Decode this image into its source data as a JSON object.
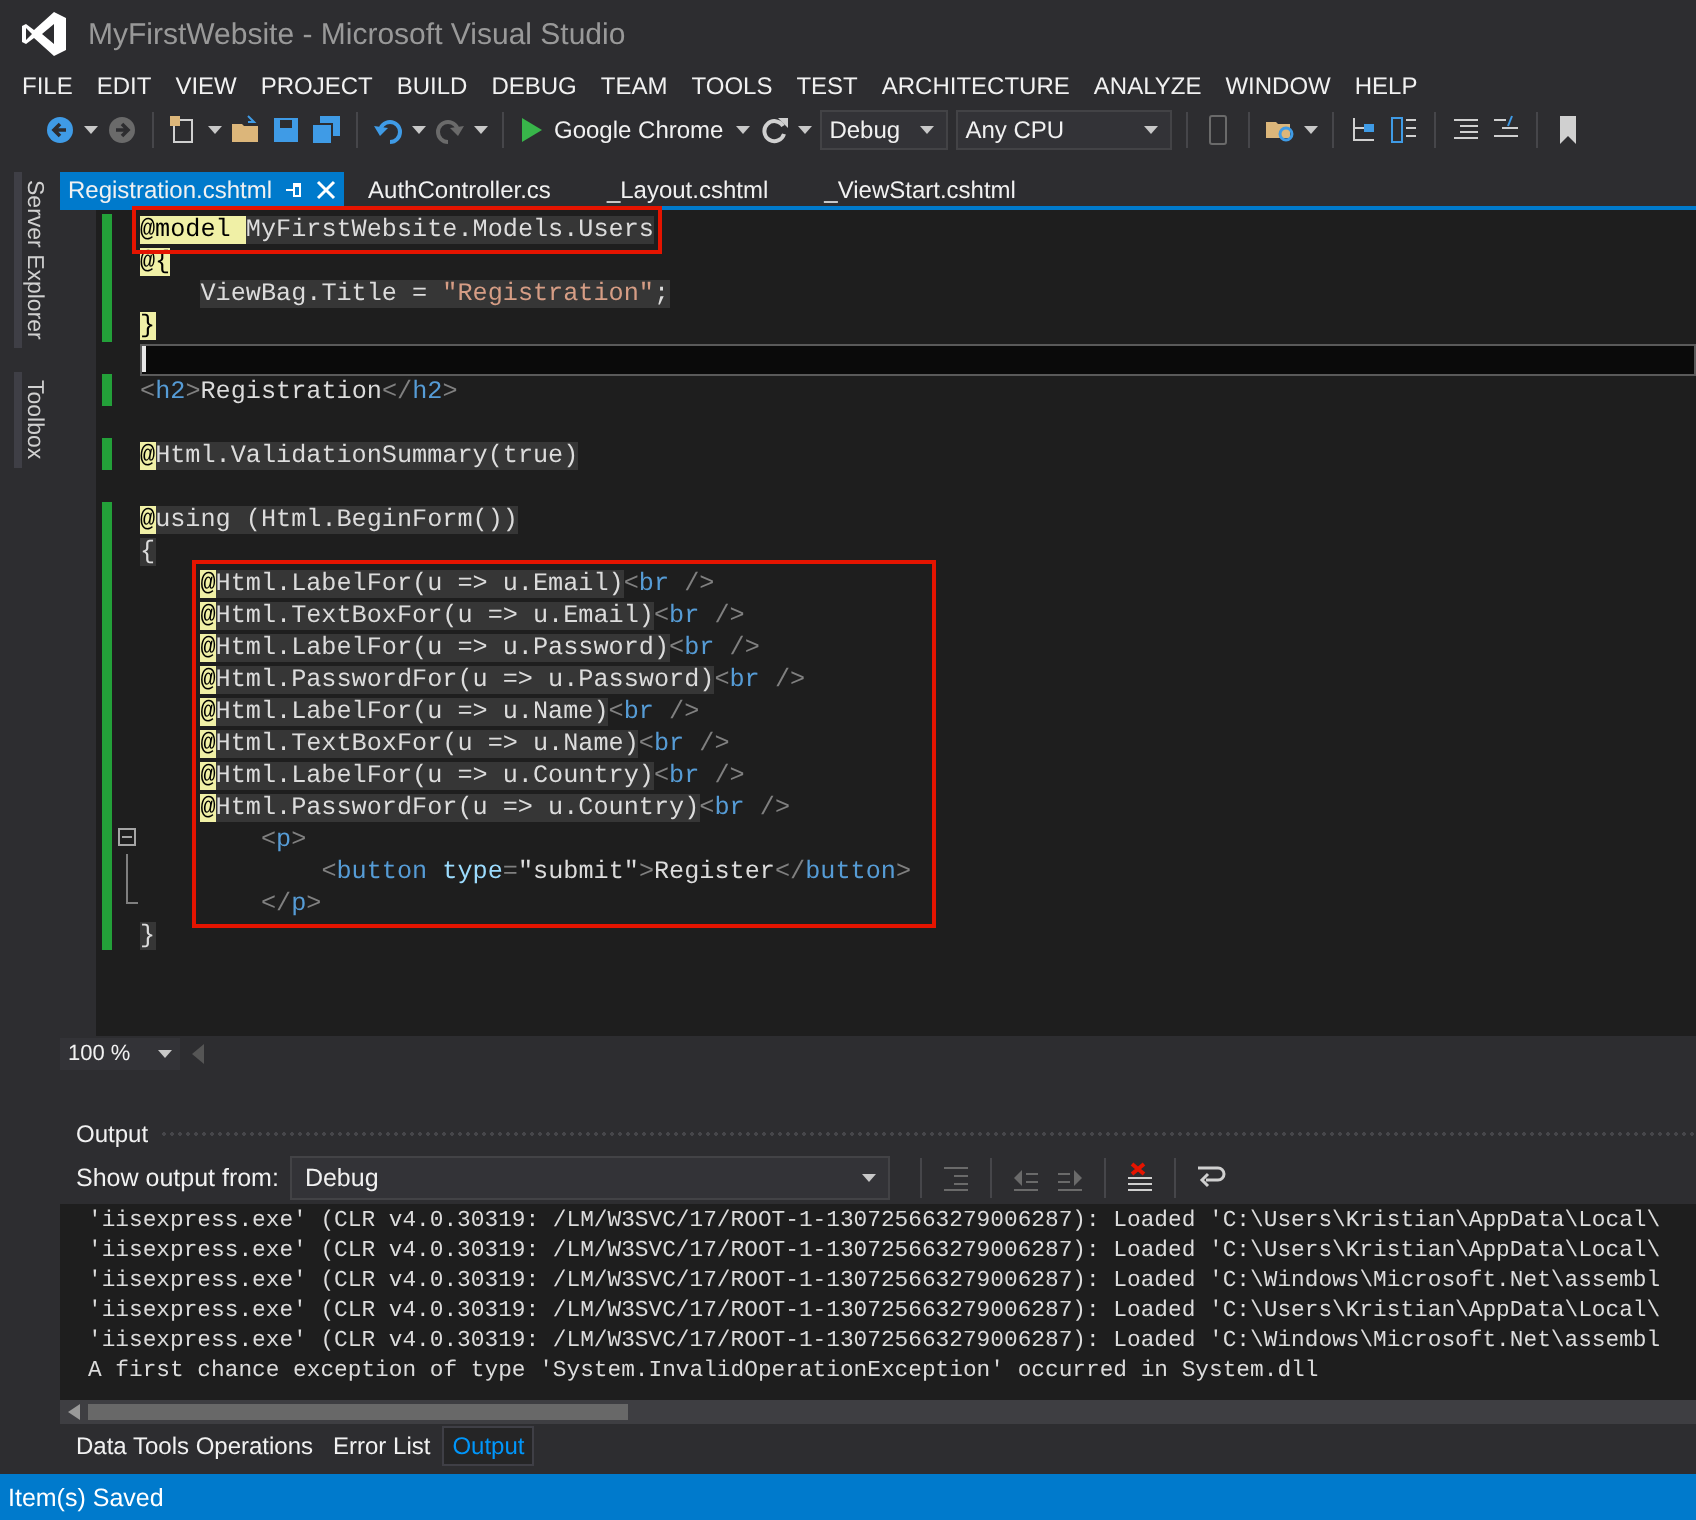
{
  "window": {
    "title": "MyFirstWebsite - Microsoft Visual Studio"
  },
  "menu": [
    "FILE",
    "EDIT",
    "VIEW",
    "PROJECT",
    "BUILD",
    "DEBUG",
    "TEAM",
    "TOOLS",
    "TEST",
    "ARCHITECTURE",
    "ANALYZE",
    "WINDOW",
    "HELP"
  ],
  "toolbar": [
    {
      "kind": "back",
      "disabled": false
    },
    {
      "kind": "caret"
    },
    {
      "kind": "forward",
      "disabled": true
    },
    {
      "kind": "sep"
    },
    {
      "kind": "new",
      "disabled": false
    },
    {
      "kind": "caret"
    },
    {
      "kind": "open",
      "disabled": false
    },
    {
      "kind": "save",
      "disabled": false
    },
    {
      "kind": "saveall",
      "disabled": false
    },
    {
      "kind": "sep"
    },
    {
      "kind": "undo",
      "disabled": false
    },
    {
      "kind": "caret"
    },
    {
      "kind": "redo",
      "disabled": true
    },
    {
      "kind": "caret"
    },
    {
      "kind": "sep"
    },
    {
      "kind": "run",
      "label": "Google Chrome"
    },
    {
      "kind": "caret"
    },
    {
      "kind": "refresh",
      "disabled": false
    },
    {
      "kind": "caret"
    },
    {
      "kind": "config",
      "value": "Debug"
    },
    {
      "kind": "platform",
      "value": "Any CPU"
    },
    {
      "kind": "sep"
    },
    {
      "kind": "device",
      "disabled": true
    },
    {
      "kind": "sep"
    },
    {
      "kind": "find",
      "disabled": false
    },
    {
      "kind": "caret"
    },
    {
      "kind": "sep"
    },
    {
      "kind": "tree",
      "disabled": false
    },
    {
      "kind": "list",
      "disabled": false
    },
    {
      "kind": "sep"
    },
    {
      "kind": "lines",
      "disabled": false
    },
    {
      "kind": "comment",
      "disabled": false
    },
    {
      "kind": "sep"
    },
    {
      "kind": "bookmark",
      "disabled": false
    }
  ],
  "side_tabs": [
    "Server Explorer",
    "Toolbox"
  ],
  "tabs": [
    {
      "label": "Registration.cshtml",
      "selected": true
    },
    {
      "label": "AuthController.cs",
      "selected": false
    },
    {
      "label": "_Layout.cshtml",
      "selected": false
    },
    {
      "label": "_ViewStart.cshtml",
      "selected": false
    }
  ],
  "code": {
    "blocks": [
      {
        "framed": true,
        "kind": "top",
        "lines": [
          {
            "changed": true,
            "current": false,
            "kind": "directive",
            "text": "@model MyFirstWebsite.Models.Users"
          }
        ]
      },
      {
        "framed": false,
        "kind": "top",
        "lines": [
          {
            "changed": true,
            "current": false,
            "kind": "brace",
            "text": "@{"
          },
          {
            "changed": true,
            "current": false,
            "kind": "code",
            "text": "    ViewBag.Title = \"Registration\";"
          },
          {
            "changed": true,
            "current": false,
            "kind": "brace",
            "text": "}"
          },
          {
            "changed": false,
            "current": true
          },
          {
            "changed": true,
            "current": false,
            "kind": "markup",
            "text": "<h2>Registration</h2>"
          },
          {
            "changed": false,
            "current": false
          },
          {
            "changed": true,
            "current": false,
            "kind": "razor",
            "text": "@Html.ValidationSummary(true)"
          },
          {
            "changed": false,
            "current": false
          },
          {
            "changed": true,
            "current": false,
            "kind": "razor",
            "text": "@using (Html.BeginForm())"
          },
          {
            "changed": true,
            "current": false,
            "kind": "code",
            "text": "{"
          }
        ]
      },
      {
        "framed": true,
        "kind": "nested",
        "lines": [
          {
            "changed": true,
            "current": false,
            "kind": "razor",
            "text": "@Html.LabelFor(u => u.Email)<br />"
          },
          {
            "changed": true,
            "current": false,
            "kind": "razor",
            "text": "@Html.TextBoxFor(u => u.Email)<br />"
          },
          {
            "changed": true,
            "current": false,
            "kind": "razor",
            "text": "@Html.LabelFor(u => u.Password)<br />"
          },
          {
            "changed": true,
            "current": false,
            "kind": "razor",
            "text": "@Html.PasswordFor(u => u.Password)<br />"
          },
          {
            "changed": true,
            "current": false,
            "kind": "razor",
            "text": "@Html.LabelFor(u => u.Name)<br />"
          },
          {
            "changed": true,
            "current": false,
            "kind": "razor",
            "text": "@Html.TextBoxFor(u => u.Name)<br />"
          },
          {
            "changed": true,
            "current": false,
            "kind": "razor",
            "text": "@Html.LabelFor(u => u.Country)<br />"
          },
          {
            "changed": true,
            "current": false,
            "kind": "razor",
            "text": "@Html.PasswordFor(u => u.Country)<br />"
          },
          {
            "changed": true,
            "current": false,
            "collapsible": true,
            "kind": "markup",
            "text": "    <p>"
          },
          {
            "changed": true,
            "current": false,
            "kind": "markup",
            "text": "        <button type=\"submit\">Register</button>"
          },
          {
            "changed": true,
            "current": false,
            "kind": "markup",
            "text": "    </p>"
          }
        ]
      },
      {
        "framed": false,
        "kind": "top",
        "lines": [
          {
            "changed": true,
            "current": false,
            "kind": "code",
            "text": "}"
          }
        ]
      }
    ]
  },
  "zoom": {
    "value": "100 %"
  },
  "output": {
    "title": "Output",
    "source_label": "Show output from:",
    "source": "Debug",
    "tools": [
      {
        "kind": "outdent",
        "disabled": true
      },
      {
        "kind": "prev",
        "disabled": true
      },
      {
        "kind": "next",
        "disabled": true
      },
      {
        "kind": "clear",
        "disabled": false
      },
      {
        "kind": "wrap",
        "disabled": false
      }
    ],
    "lines": [
      "'iisexpress.exe' (CLR v4.0.30319: /LM/W3SVC/17/ROOT-1-130725663279006287): Loaded 'C:\\Users\\Kristian\\AppData\\Local\\",
      "'iisexpress.exe' (CLR v4.0.30319: /LM/W3SVC/17/ROOT-1-130725663279006287): Loaded 'C:\\Users\\Kristian\\AppData\\Local\\",
      "'iisexpress.exe' (CLR v4.0.30319: /LM/W3SVC/17/ROOT-1-130725663279006287): Loaded 'C:\\Windows\\Microsoft.Net\\assembl",
      "'iisexpress.exe' (CLR v4.0.30319: /LM/W3SVC/17/ROOT-1-130725663279006287): Loaded 'C:\\Users\\Kristian\\AppData\\Local\\",
      "'iisexpress.exe' (CLR v4.0.30319: /LM/W3SVC/17/ROOT-1-130725663279006287): Loaded 'C:\\Windows\\Microsoft.Net\\assembl",
      "A first chance exception of type 'System.InvalidOperationException' occurred in System.dll"
    ]
  },
  "bottom_tabs": [
    {
      "label": "Data Tools Operations",
      "selected": false
    },
    {
      "label": "Error List",
      "selected": false
    },
    {
      "label": "Output",
      "selected": true
    }
  ],
  "status_bar": {
    "text": "Item(s) Saved"
  }
}
